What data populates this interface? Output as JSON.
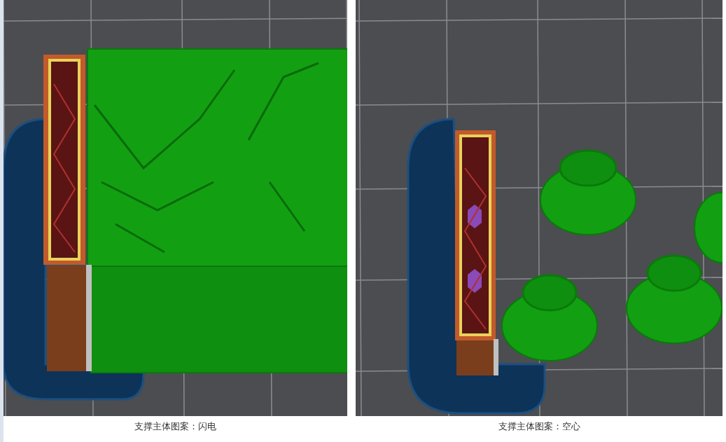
{
  "figures": [
    {
      "kind": "lightning",
      "caption": "支撑主体图案：闪电"
    },
    {
      "kind": "hollow",
      "caption": "支撑主体图案：空心"
    }
  ]
}
